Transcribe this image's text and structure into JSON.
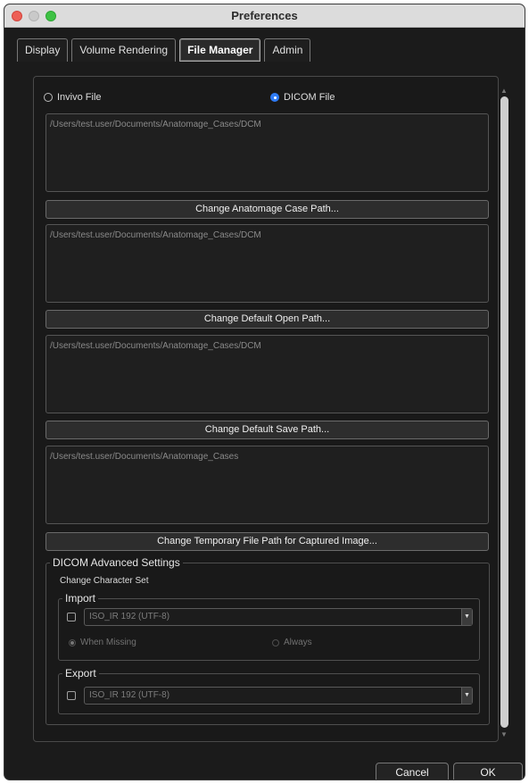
{
  "window": {
    "title": "Preferences"
  },
  "tabs": [
    {
      "label": "Display",
      "active": false
    },
    {
      "label": "Volume Rendering",
      "active": false
    },
    {
      "label": "File Manager",
      "active": true
    },
    {
      "label": "Admin",
      "active": false
    }
  ],
  "file_type": {
    "invivo_label": "Invivo File",
    "dicom_label": "DICOM File",
    "selected": "DICOM File"
  },
  "paths": [
    {
      "value": "/Users/test.user/Documents/Anatomage_Cases/DCM",
      "button": "Change Anatomage Case Path..."
    },
    {
      "value": "/Users/test.user/Documents/Anatomage_Cases/DCM",
      "button": "Change Default Open Path..."
    },
    {
      "value": "/Users/test.user/Documents/Anatomage_Cases/DCM",
      "button": "Change Default Save Path..."
    },
    {
      "value": "/Users/test.user/Documents/Anatomage_Cases",
      "button": "Change Temporary File Path for Captured Image..."
    }
  ],
  "dicom_advanced": {
    "title": "DICOM Advanced Settings",
    "charset_label": "Change Character Set",
    "import": {
      "title": "Import",
      "checked": false,
      "charset": "ISO_IR 192 (UTF-8)",
      "when_missing_label": "When Missing",
      "always_label": "Always",
      "selected_option": "When Missing"
    },
    "export": {
      "title": "Export",
      "checked": false,
      "charset": "ISO_IR 192 (UTF-8)"
    }
  },
  "footer": {
    "cancel": "Cancel",
    "ok": "OK"
  },
  "colors": {
    "accent": "#2f7cf6",
    "background": "#1b1b1b",
    "close": "#ed5f56",
    "maximize": "#3ec244"
  }
}
